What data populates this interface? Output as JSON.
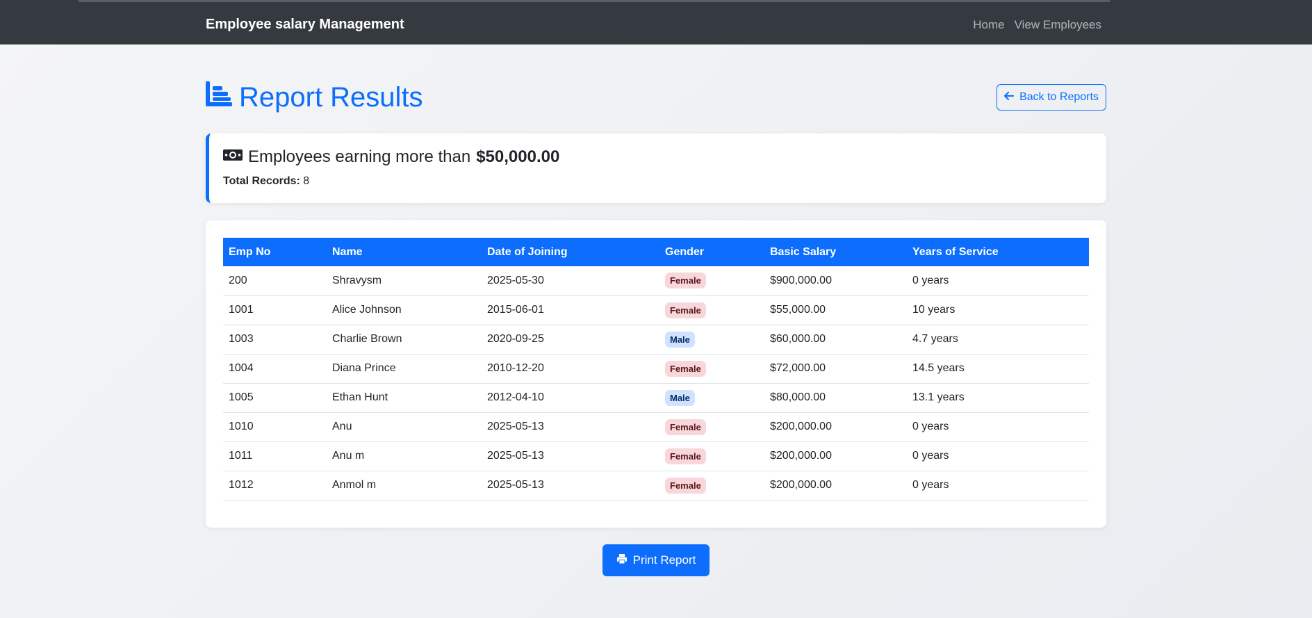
{
  "navbar": {
    "brand": "Employee salary Management",
    "links": [
      {
        "label": "Home"
      },
      {
        "label": "View Employees"
      }
    ]
  },
  "header": {
    "title": "Report Results",
    "title_icon": "chart-bar-icon",
    "back_button": "Back to Reports",
    "back_icon": "arrow-left-icon"
  },
  "summary": {
    "icon": "money-bill-icon",
    "heading_prefix": "Employees earning more than",
    "heading_amount": "$50,000.00",
    "total_label": "Total Records:",
    "total_value": "8"
  },
  "table": {
    "columns": [
      "Emp No",
      "Name",
      "Date of Joining",
      "Gender",
      "Basic Salary",
      "Years of Service"
    ],
    "rows": [
      {
        "emp_no": "200",
        "name": "Shravysm",
        "doj": "2025-05-30",
        "gender": "Female",
        "salary": "$900,000.00",
        "years": "0 years"
      },
      {
        "emp_no": "1001",
        "name": "Alice Johnson",
        "doj": "2015-06-01",
        "gender": "Female",
        "salary": "$55,000.00",
        "years": "10 years"
      },
      {
        "emp_no": "1003",
        "name": "Charlie Brown",
        "doj": "2020-09-25",
        "gender": "Male",
        "salary": "$60,000.00",
        "years": "4.7 years"
      },
      {
        "emp_no": "1004",
        "name": "Diana Prince",
        "doj": "2010-12-20",
        "gender": "Female",
        "salary": "$72,000.00",
        "years": "14.5 years"
      },
      {
        "emp_no": "1005",
        "name": "Ethan Hunt",
        "doj": "2012-04-10",
        "gender": "Male",
        "salary": "$80,000.00",
        "years": "13.1 years"
      },
      {
        "emp_no": "1010",
        "name": "Anu",
        "doj": "2025-05-13",
        "gender": "Female",
        "salary": "$200,000.00",
        "years": "0 years"
      },
      {
        "emp_no": "1011",
        "name": "Anu m",
        "doj": "2025-05-13",
        "gender": "Female",
        "salary": "$200,000.00",
        "years": "0 years"
      },
      {
        "emp_no": "1012",
        "name": "Anmol m",
        "doj": "2025-05-13",
        "gender": "Female",
        "salary": "$200,000.00",
        "years": "0 years"
      }
    ]
  },
  "footer": {
    "print_button": "Print Report",
    "print_icon": "printer-icon"
  },
  "colors": {
    "primary": "#0d6efd",
    "navbar": "#343a40",
    "female_badge_bg": "#f8d7da",
    "male_badge_bg": "#cfe2ff"
  }
}
